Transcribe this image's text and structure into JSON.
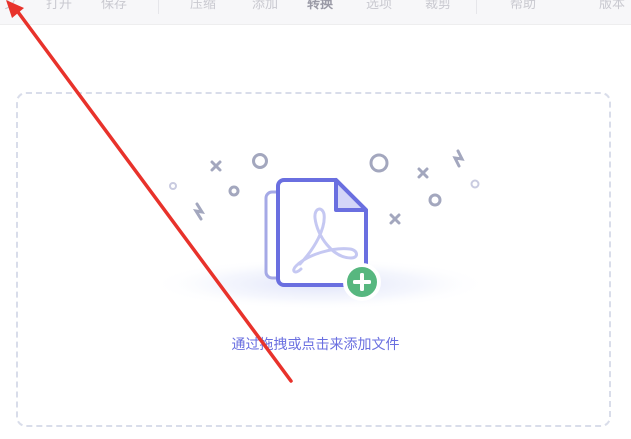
{
  "toolbar": {
    "items": [
      {
        "label": "文"
      },
      {
        "label": "打开"
      },
      {
        "label": "保存"
      },
      {
        "label": "压缩"
      },
      {
        "label": "添加"
      },
      {
        "label": "转换"
      },
      {
        "label": "选项"
      },
      {
        "label": "裁剪"
      },
      {
        "label": "帮助"
      },
      {
        "label": "版本"
      }
    ],
    "active_index": 5
  },
  "drop_area": {
    "instruction": "通过拖拽或点击来添加文件",
    "accent_color": "#6a6fe0",
    "plus_color": "#57b77f",
    "icon": "pdf-file-add-icon"
  },
  "annotation": {
    "arrow_color": "#e8322b"
  }
}
